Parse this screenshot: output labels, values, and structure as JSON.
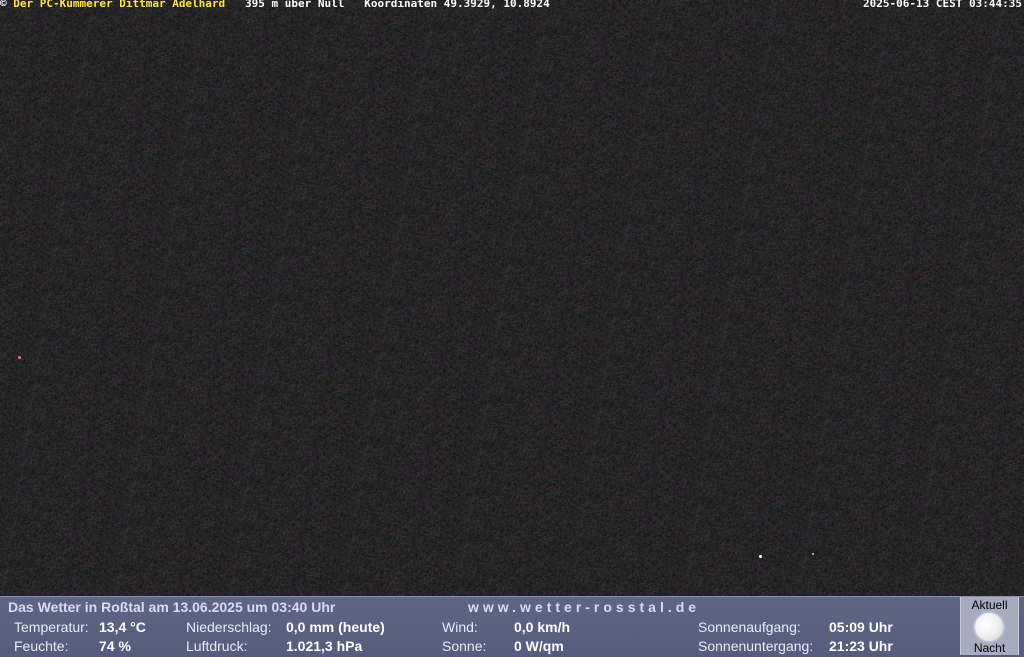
{
  "overlay": {
    "copyright": "©",
    "author": "Der PC-Kümmerer Dittmar Adelhard",
    "altitude": "395 m über Null",
    "coordinates": "Koordinaten 49.3929, 10.8924",
    "timestamp": "2025-06-13 CEST 03:44:35"
  },
  "panel": {
    "title": "Das Wetter in Roßtal am 13.06.2025 um 03:40 Uhr",
    "url": "www.wetter-rosstal.de",
    "temperature": {
      "label": "Temperatur:",
      "value": "13,4 °C"
    },
    "humidity": {
      "label": "Feuchte:",
      "value": "74 %"
    },
    "precipitation": {
      "label": "Niederschlag:",
      "value": "0,0 mm (heute)"
    },
    "pressure": {
      "label": "Luftdruck:",
      "value": "1.021,3 hPa"
    },
    "wind": {
      "label": "Wind:",
      "value": "0,0 km/h"
    },
    "sun": {
      "label": "Sonne:",
      "value": "0 W/qm"
    },
    "sunrise": {
      "label": "Sonnenaufgang:",
      "value": "05:09 Uhr"
    },
    "sunset": {
      "label": "Sonnenuntergang:",
      "value": "21:23 Uhr"
    },
    "moon": {
      "top_label": "Aktuell",
      "bottom_label": "Nacht",
      "icon": "full-moon-icon"
    }
  },
  "colors": {
    "author_text": "#ffe44a",
    "panel_bg": "#5f6585",
    "moon_box_bg": "#a7abc0"
  }
}
